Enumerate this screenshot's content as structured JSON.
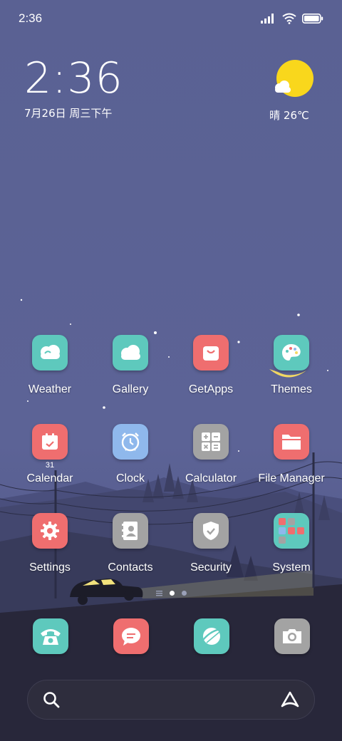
{
  "status_bar": {
    "time": "2:36"
  },
  "clock_widget": {
    "time": "2:36",
    "date": "7月26日 周三下午"
  },
  "weather_widget": {
    "text": "晴 26℃",
    "icon": "sun-cloud-icon"
  },
  "apps": [
    {
      "label": "Weather",
      "icon": "weather-icon",
      "color": "#5ec9bd"
    },
    {
      "label": "Gallery",
      "icon": "cloud-icon",
      "color": "#5ec9bd"
    },
    {
      "label": "GetApps",
      "icon": "shopping-bag-icon",
      "color": "#ef6e6f"
    },
    {
      "label": "Themes",
      "icon": "palette-icon",
      "color": "#5ec9bd"
    },
    {
      "label": "Calendar",
      "icon": "calendar-icon",
      "color": "#ef6e6f",
      "badge": "31"
    },
    {
      "label": "Clock",
      "icon": "alarm-clock-icon",
      "color": "#8fb8ec"
    },
    {
      "label": "Calculator",
      "icon": "calculator-icon",
      "color": "#a3a3a3"
    },
    {
      "label": "File Manager",
      "icon": "folder-icon",
      "color": "#ef6e6f"
    },
    {
      "label": "Settings",
      "icon": "gear-icon",
      "color": "#ef6e6f"
    },
    {
      "label": "Contacts",
      "icon": "contacts-icon",
      "color": "#a3a3a3"
    },
    {
      "label": "Security",
      "icon": "shield-icon",
      "color": "#a3a3a3"
    },
    {
      "label": "System",
      "icon": "folder-grid-icon",
      "color": "#5ec9bd"
    }
  ],
  "dock": [
    {
      "icon": "phone-icon",
      "color": "#5ec9bd"
    },
    {
      "icon": "message-icon",
      "color": "#ef6e6f"
    },
    {
      "icon": "browser-icon",
      "color": "#5ec9bd"
    },
    {
      "icon": "camera-icon",
      "color": "#a3a3a3"
    }
  ],
  "page_indicator": {
    "pages": 3,
    "active": 1
  },
  "search": {
    "left_icon": "search-icon",
    "right_icon": "assistant-icon"
  }
}
